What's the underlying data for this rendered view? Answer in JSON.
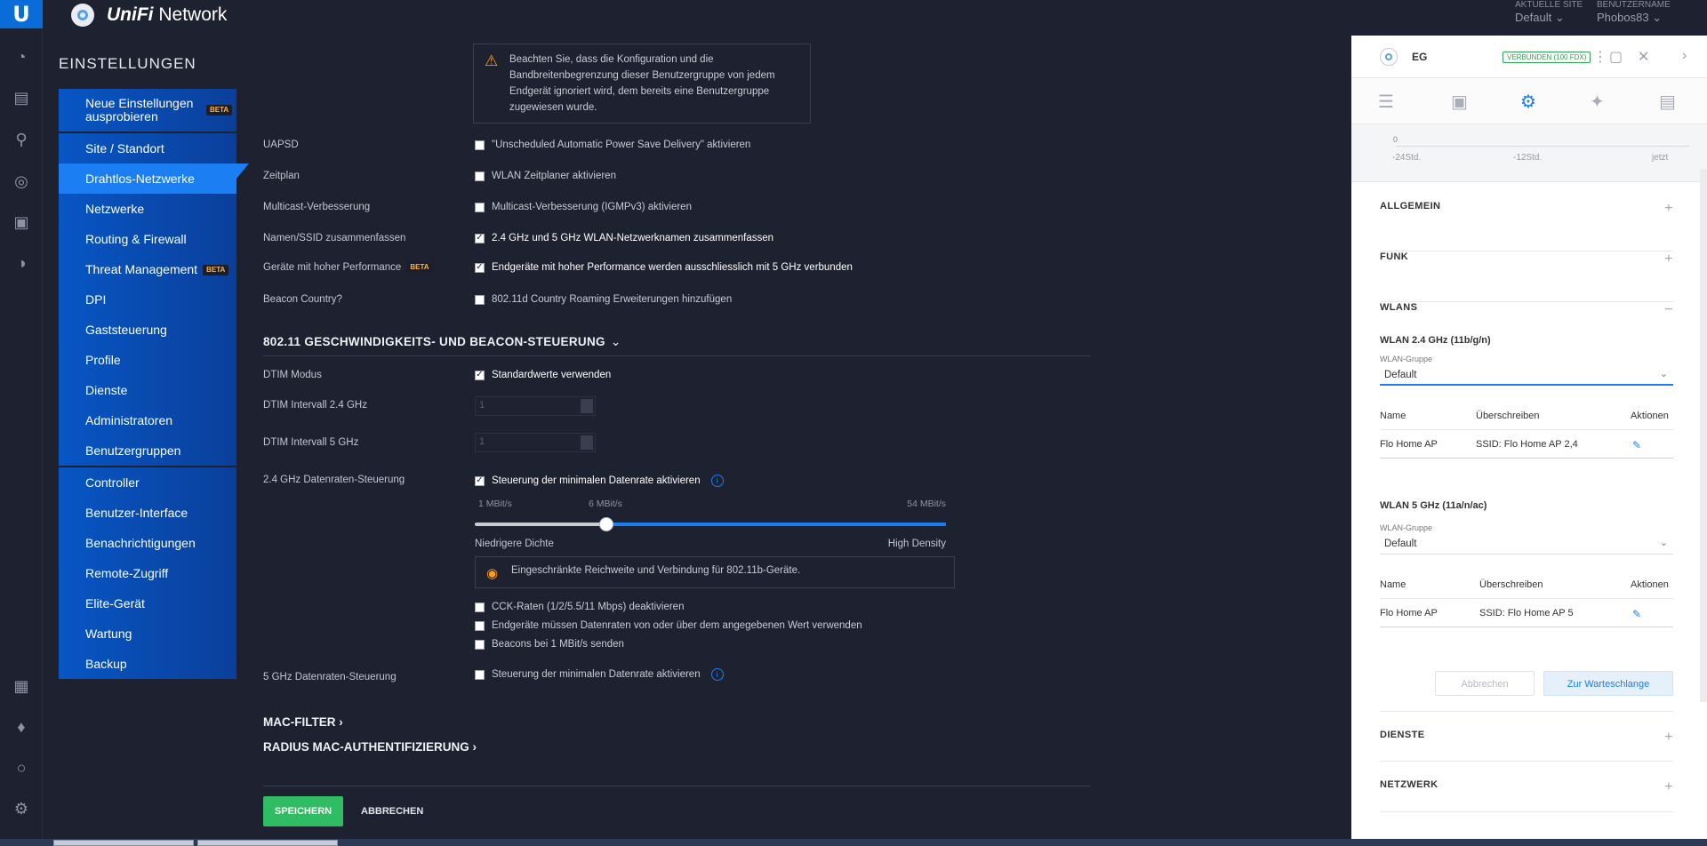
{
  "header": {
    "app_name_prefix": "UniFi",
    "app_name_suffix": "Network",
    "site_label": "AKTUELLE SITE",
    "site_value": "Default",
    "user_label": "BENUTZERNAME",
    "user_value": "Phobos83"
  },
  "rail_icons": [
    "dashboard-icon",
    "statistics-icon",
    "map-icon",
    "devices-icon",
    "clients-icon",
    "insights-icon",
    "events-icon",
    "alerts-icon",
    "chat-icon",
    "settings-icon"
  ],
  "settings": {
    "title": "EINSTELLUNGEN",
    "beta": "BETA",
    "group1": [
      {
        "label": "Neue Einstellungen ausprobieren"
      }
    ],
    "group2": [
      {
        "label": "Site / Standort"
      },
      {
        "label": "Drahtlos-Netzwerke"
      },
      {
        "label": "Netzwerke"
      },
      {
        "label": "Routing & Firewall"
      },
      {
        "label": "Threat Management"
      },
      {
        "label": "DPI"
      },
      {
        "label": "Gaststeuerung"
      },
      {
        "label": "Profile"
      },
      {
        "label": "Dienste"
      },
      {
        "label": "Administratoren"
      },
      {
        "label": "Benutzergruppen"
      }
    ],
    "group3": [
      {
        "label": "Controller"
      },
      {
        "label": "Benutzer-Interface"
      },
      {
        "label": "Benachrichtigungen"
      },
      {
        "label": "Remote-Zugriff"
      },
      {
        "label": "Elite-Gerät"
      },
      {
        "label": "Wartung"
      },
      {
        "label": "Backup"
      }
    ]
  },
  "main": {
    "warning": "Beachten Sie, dass die Konfiguration und die Bandbreitenbegrenzung dieser Benutzergruppe von jedem Endgerät ignoriert wird, dem bereits eine Benutzergruppe zugewiesen wurde.",
    "options": [
      {
        "label": "UAPSD",
        "text": "\"Unscheduled Automatic Power Save Delivery\" aktivieren",
        "checked": false
      },
      {
        "label": "Zeitplan",
        "text": "WLAN Zeitplaner aktivieren",
        "checked": false
      },
      {
        "label": "Multicast-Verbesserung",
        "text": "Multicast-Verbesserung (IGMPv3) aktivieren",
        "checked": false
      },
      {
        "label": "Namen/SSID zusammenfassen",
        "text": "2.4 GHz und 5 GHz WLAN-Netzwerknamen zusammenfassen",
        "checked": true
      },
      {
        "label": "Geräte mit hoher Performance",
        "text": "Endgeräte mit hoher Performance werden ausschliesslich mit 5 GHz verbunden",
        "checked": true
      },
      {
        "label": "Beacon Country?",
        "text": "802.11d Country Roaming Erweiterungen hinzufügen",
        "checked": false
      }
    ],
    "section_rate": "802.11 GESCHWINDIGKEITS- UND BEACON-STEUERUNG",
    "dtim_mode_label": "DTIM Modus",
    "dtim_mode_text": "Standardwerte verwenden",
    "dtim24_label": "DTIM Intervall 2.4 GHz",
    "dtim24_value": "1",
    "dtim5_label": "DTIM Intervall 5 GHz",
    "dtim5_value": "1",
    "rate24_label": "2.4 GHz Datenraten-Steuerung",
    "rate24_text": "Steuerung der minimalen Datenrate aktivieren",
    "slider": {
      "min": "1 MBit/s",
      "current": "6 MBit/s",
      "max": "54 MBit/s",
      "fraction": 0.28,
      "low_label": "Niedrigere Dichte",
      "high_label": "High Density"
    },
    "notice": "Eingeschränkte Reichweite und Verbindung für 802.11b-Geräte.",
    "sub_options": [
      {
        "text": "CCK-Raten (1/2/5.5/11 Mbps) deaktivieren",
        "checked": false
      },
      {
        "text": "Endgeräte müssen Datenraten von oder über dem angegebenen Wert verwenden",
        "checked": false
      },
      {
        "text": "Beacons bei 1 MBit/s senden",
        "checked": false
      }
    ],
    "rate5_label": "5 GHz Datenraten-Steuerung",
    "rate5_text": "Steuerung der minimalen Datenrate aktivieren",
    "mac_filter": "MAC-FILTER",
    "radius": "RADIUS MAC-AUTHENTIFIZIERUNG",
    "save": "SPEICHERN",
    "cancel": "ABBRECHEN"
  },
  "panel": {
    "device": "EG",
    "status": "VERBUNDEN (100 FDX)",
    "graph_zero": "0",
    "graph_ticks": [
      "-24Std.",
      "-12Std.",
      "jetzt"
    ],
    "sec_general": "ALLGEMEIN",
    "sec_radio": "FUNK",
    "sec_wlans": "WLANS",
    "wlan24_title": "WLAN 2.4 GHz (11b/g/n)",
    "wlan5_title": "WLAN 5 GHz (11a/n/ac)",
    "group_label": "WLAN-Gruppe",
    "group24_value": "Default",
    "group5_value": "Default",
    "col_name": "Name",
    "col_override": "Überschreiben",
    "col_actions": "Aktionen",
    "row24_name": "Flo Home AP",
    "row24_override": "SSID: Flo Home AP 2,4",
    "row5_name": "Flo Home AP",
    "row5_override": "SSID: Flo Home AP 5",
    "btn_cancel": "Abbrechen",
    "btn_queue": "Zur Warteschlange",
    "sec_services": "DIENSTE",
    "sec_network": "NETZWERK"
  }
}
